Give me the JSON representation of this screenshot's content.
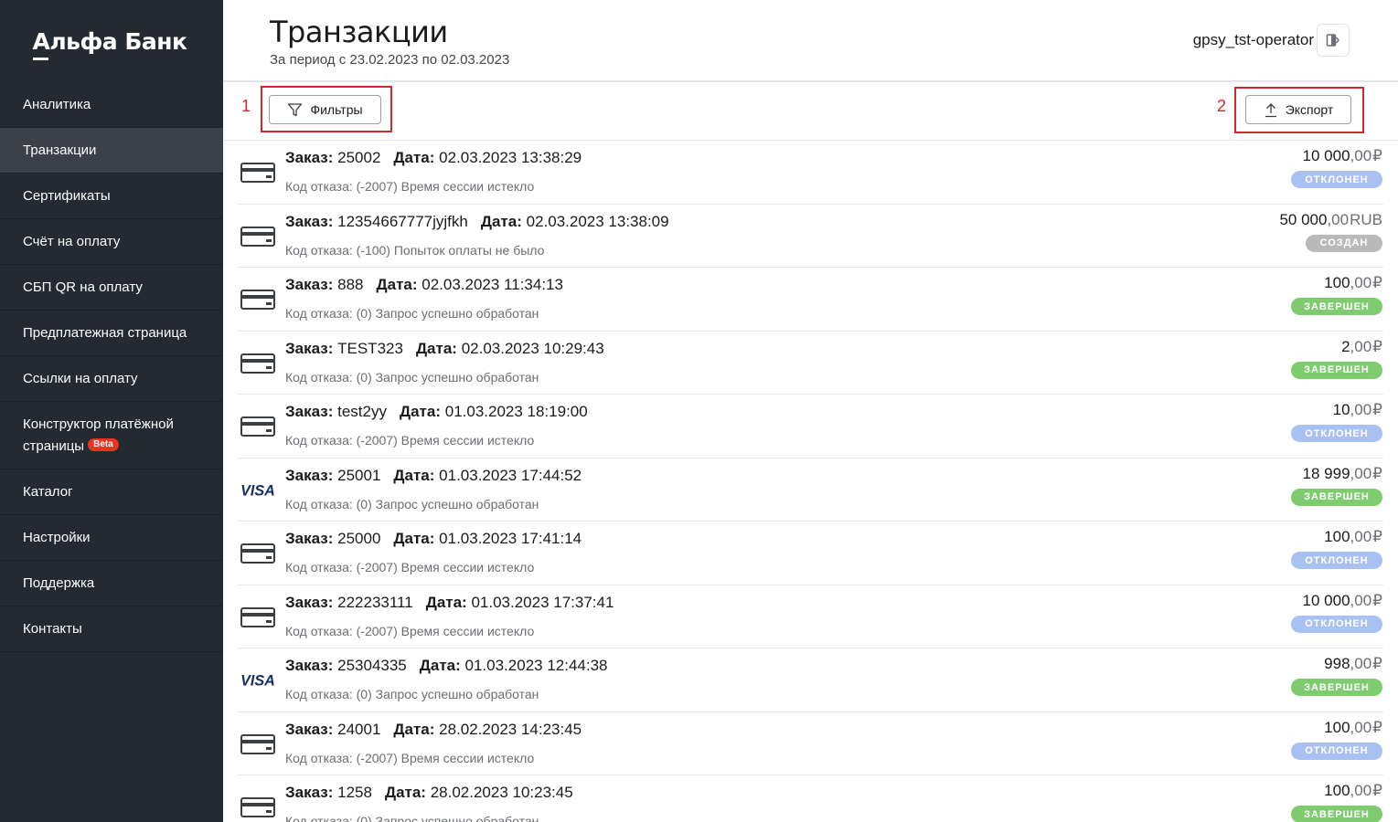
{
  "brand": {
    "name": "Альфа Банк"
  },
  "sidebar": {
    "items": [
      {
        "label": "Аналитика",
        "active": false
      },
      {
        "label": "Транзакции",
        "active": true
      },
      {
        "label": "Сертификаты",
        "active": false
      },
      {
        "label": "Счёт на оплату",
        "active": false
      },
      {
        "label": "СБП QR на оплату",
        "active": false
      },
      {
        "label": "Предплатежная страница",
        "active": false
      },
      {
        "label": "Ссылки на оплату",
        "active": false
      },
      {
        "label": "Конструктор платёжной страницы",
        "active": false,
        "badge": "Beta"
      },
      {
        "label": "Каталог",
        "active": false
      },
      {
        "label": "Настройки",
        "active": false
      },
      {
        "label": "Поддержка",
        "active": false
      },
      {
        "label": "Контакты",
        "active": false
      }
    ]
  },
  "header": {
    "title": "Транзакции",
    "period": "За период с 23.02.2023 по 02.03.2023",
    "user": "gpsy_tst-operator",
    "logout_icon": "logout-icon"
  },
  "toolbar": {
    "filter_label": "Фильтры",
    "filter_annotation": "1",
    "export_label": "Экспорт",
    "export_annotation": "2"
  },
  "labels": {
    "order": "Заказ:",
    "date": "Дата:"
  },
  "colors": {
    "sidebar_bg": "#232a31",
    "annotation_red": "#d0282d",
    "status_declined": "#a9c1f2",
    "status_created": "#b9b9b9",
    "status_done": "#7fcb6f",
    "beta_badge": "#ef3124"
  },
  "transactions": [
    {
      "order": "25002",
      "date": "02.03.2023 13:38:29",
      "reason": "Код отказа: (-2007) Время сессии истекло",
      "amount_int": "10 000",
      "amount_dec": ",00",
      "currency": "₽",
      "status": "ОТКЛОНЕН",
      "status_kind": "declined",
      "method": "card"
    },
    {
      "order": "12354667777jyjfkh",
      "date": "02.03.2023 13:38:09",
      "reason": "Код отказа: (-100) Попыток оплаты не было",
      "amount_int": "50 000",
      "amount_dec": ",00",
      "currency": "RUB",
      "status": "СОЗДАН",
      "status_kind": "created",
      "method": "card"
    },
    {
      "order": "888",
      "date": "02.03.2023 11:34:13",
      "reason": "Код отказа: (0) Запрос успешно обработан",
      "amount_int": "100",
      "amount_dec": ",00",
      "currency": "₽",
      "status": "ЗАВЕРШЕН",
      "status_kind": "done",
      "method": "card"
    },
    {
      "order": "TEST323",
      "date": "02.03.2023 10:29:43",
      "reason": "Код отказа: (0) Запрос успешно обработан",
      "amount_int": "2",
      "amount_dec": ",00",
      "currency": "₽",
      "status": "ЗАВЕРШЕН",
      "status_kind": "done",
      "method": "card"
    },
    {
      "order": "test2yy",
      "date": "01.03.2023 18:19:00",
      "reason": "Код отказа: (-2007) Время сессии истекло",
      "amount_int": "10",
      "amount_dec": ",00",
      "currency": "₽",
      "status": "ОТКЛОНЕН",
      "status_kind": "declined",
      "method": "card"
    },
    {
      "order": "25001",
      "date": "01.03.2023 17:44:52",
      "reason": "Код отказа: (0) Запрос успешно обработан",
      "amount_int": "18 999",
      "amount_dec": ",00",
      "currency": "₽",
      "status": "ЗАВЕРШЕН",
      "status_kind": "done",
      "method": "visa"
    },
    {
      "order": "25000",
      "date": "01.03.2023 17:41:14",
      "reason": "Код отказа: (-2007) Время сессии истекло",
      "amount_int": "100",
      "amount_dec": ",00",
      "currency": "₽",
      "status": "ОТКЛОНЕН",
      "status_kind": "declined",
      "method": "card"
    },
    {
      "order": "222233111",
      "date": "01.03.2023 17:37:41",
      "reason": "Код отказа: (-2007) Время сессии истекло",
      "amount_int": "10 000",
      "amount_dec": ",00",
      "currency": "₽",
      "status": "ОТКЛОНЕН",
      "status_kind": "declined",
      "method": "card"
    },
    {
      "order": "25304335",
      "date": "01.03.2023 12:44:38",
      "reason": "Код отказа: (0) Запрос успешно обработан",
      "amount_int": "998",
      "amount_dec": ",00",
      "currency": "₽",
      "status": "ЗАВЕРШЕН",
      "status_kind": "done",
      "method": "visa"
    },
    {
      "order": "24001",
      "date": "28.02.2023 14:23:45",
      "reason": "Код отказа: (-2007) Время сессии истекло",
      "amount_int": "100",
      "amount_dec": ",00",
      "currency": "₽",
      "status": "ОТКЛОНЕН",
      "status_kind": "declined",
      "method": "card"
    },
    {
      "order": "1258",
      "date": "28.02.2023 10:23:45",
      "reason": "Код отказа: (0) Запрос успешно обработан",
      "amount_int": "100",
      "amount_dec": ",00",
      "currency": "₽",
      "status": "ЗАВЕРШЕН",
      "status_kind": "done",
      "method": "card"
    }
  ]
}
